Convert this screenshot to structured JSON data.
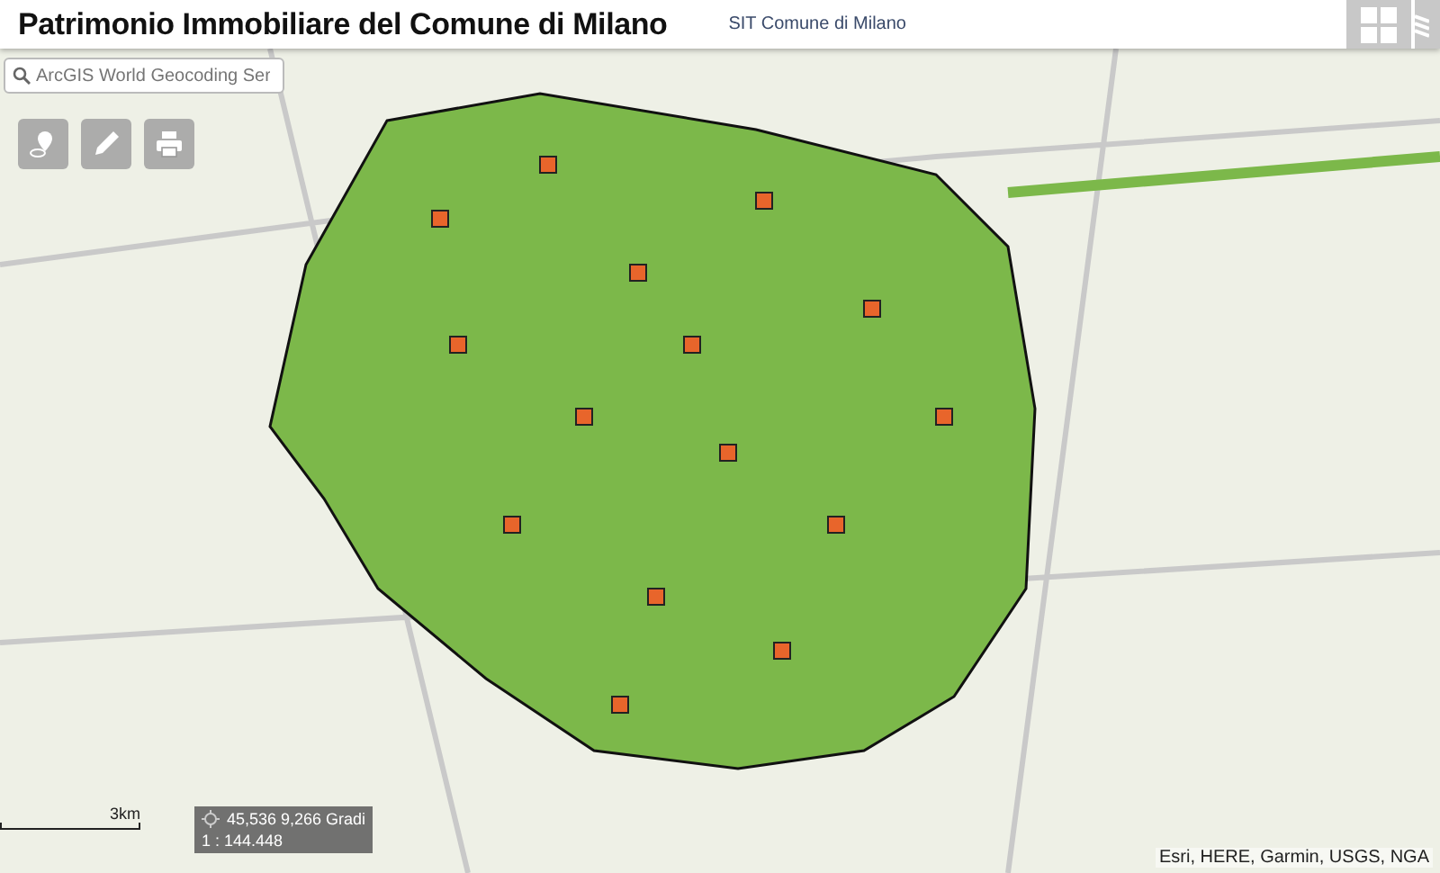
{
  "header": {
    "title": "Patrimonio Immobiliare del Comune di Milano",
    "subtitle": "SIT Comune di Milano"
  },
  "search": {
    "placeholder": "ArcGIS World Geocoding Ser"
  },
  "scale_bar": {
    "label": "3km"
  },
  "coordinates": {
    "position": "45,536 9,266 Gradi",
    "scale": "1 : 144.448"
  },
  "attribution": "Esri, HERE, Garmin, USGS, NGA"
}
